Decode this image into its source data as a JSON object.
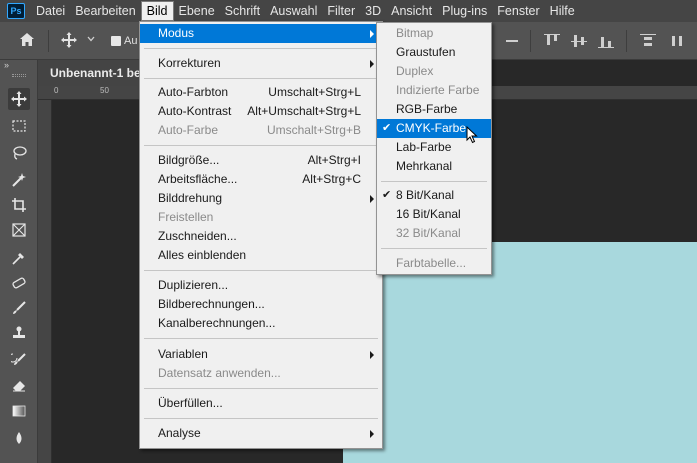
{
  "app": {
    "logo": "Ps"
  },
  "menubar": [
    "Datei",
    "Bearbeiten",
    "Bild",
    "Ebene",
    "Schrift",
    "Auswahl",
    "Filter",
    "3D",
    "Ansicht",
    "Plug-ins",
    "Fenster",
    "Hilfe"
  ],
  "menubar_active_index": 2,
  "optionsbar": {
    "auto_label": "Au",
    "icons": [
      "home-icon",
      "move-icon",
      "chevron-down-icon",
      "checkbox-icon"
    ]
  },
  "toolbar": {
    "collapse": "»",
    "tools": [
      "move-tool-icon",
      "marquee-tool-icon",
      "lasso-tool-icon",
      "magic-wand-icon",
      "crop-tool-icon",
      "frame-tool-icon",
      "eyedropper-icon",
      "healing-brush-icon",
      "brush-tool-icon",
      "clone-stamp-icon",
      "history-brush-icon",
      "eraser-icon",
      "gradient-icon",
      "blur-icon"
    ]
  },
  "document": {
    "tab_title": "Unbenannt-1 bei",
    "ruler_ticks": [
      "0",
      "50",
      "100"
    ]
  },
  "colors": {
    "highlight": "#0078d7",
    "canvas": "#a8d8dd",
    "menu_bg": "#f0f0f0"
  },
  "bild_menu": {
    "modus": "Modus",
    "korrekturen": "Korrekturen",
    "auto_farbton": "Auto-Farbton",
    "auto_farbton_sc": "Umschalt+Strg+L",
    "auto_kontrast": "Auto-Kontrast",
    "auto_kontrast_sc": "Alt+Umschalt+Strg+L",
    "auto_farbe": "Auto-Farbe",
    "auto_farbe_sc": "Umschalt+Strg+B",
    "bildgroesse": "Bildgröße...",
    "bildgroesse_sc": "Alt+Strg+I",
    "arbeitsflaeche": "Arbeitsfläche...",
    "arbeitsflaeche_sc": "Alt+Strg+C",
    "bilddrehung": "Bilddrehung",
    "freistellen": "Freistellen",
    "zuschneiden": "Zuschneiden...",
    "alles_einblenden": "Alles einblenden",
    "duplizieren": "Duplizieren...",
    "bildberechnungen": "Bildberechnungen...",
    "kanalberechnungen": "Kanalberechnungen...",
    "variablen": "Variablen",
    "datensatz": "Datensatz anwenden...",
    "ueberfuellen": "Überfüllen...",
    "analyse": "Analyse"
  },
  "modus_menu": {
    "bitmap": "Bitmap",
    "graustufen": "Graustufen",
    "duplex": "Duplex",
    "indizierte": "Indizierte Farbe",
    "rgb": "RGB-Farbe",
    "cmyk": "CMYK-Farbe",
    "lab": "Lab-Farbe",
    "mehrkanal": "Mehrkanal",
    "bit8": "8 Bit/Kanal",
    "bit16": "16 Bit/Kanal",
    "bit32": "32 Bit/Kanal",
    "farbtabelle": "Farbtabelle...",
    "checkmark": "✔"
  }
}
